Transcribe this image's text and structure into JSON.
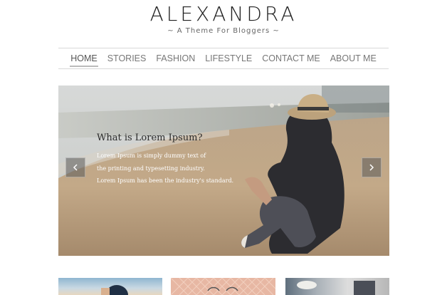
{
  "site": {
    "title": "ALEXANDRA",
    "tagline": "~ A Theme For Bloggers ~"
  },
  "nav": {
    "items": [
      {
        "label": "HOME",
        "active": true
      },
      {
        "label": "STORIES",
        "active": false
      },
      {
        "label": "FASHION",
        "active": false
      },
      {
        "label": "LIFESTYLE",
        "active": false
      },
      {
        "label": "CONTACT ME",
        "active": false
      },
      {
        "label": "ABOUT ME",
        "active": false
      }
    ]
  },
  "slider": {
    "heading": "What is Lorem Ipsum?",
    "lines": [
      "Lorem Ipsum is simply dummy text of",
      "the printing and typesetting industry.",
      "Lorem Ipsum has been the industry's standard."
    ],
    "prev_icon": "chevron-left-icon",
    "next_icon": "chevron-right-icon"
  },
  "colors": {
    "text": "#222222",
    "nav_text": "#777777",
    "divider": "#d9d9d9"
  }
}
